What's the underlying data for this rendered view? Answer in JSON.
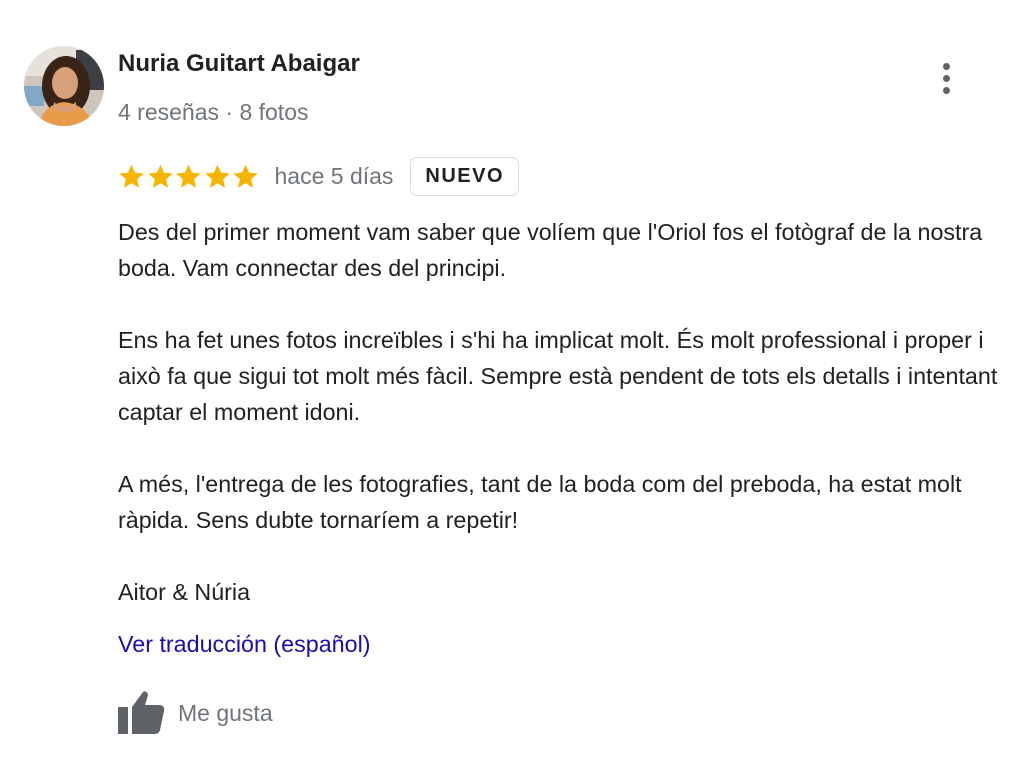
{
  "author": {
    "name": "Nuria Guitart Abaigar",
    "meta": "4 reseñas · 8 fotos"
  },
  "rating": {
    "stars": 5,
    "max_stars": 5,
    "star_color": "#f4b400",
    "time": "hace 5 días",
    "badge": "NUEVO"
  },
  "review": {
    "paragraphs": [
      "Des del primer moment vam saber que volíem que l'Oriol fos el fotògraf de la nostra boda. Vam connectar des del principi.",
      "Ens ha fet unes fotos increïbles i s'hi ha implicat molt. És molt professional i proper i això fa que sigui tot molt més fàcil. Sempre està pendent de tots els detalls i intentant captar el moment idoni.",
      "A més, l'entrega de les fotografies, tant de la boda com del preboda, ha estat molt ràpida. Sens dubte tornaríem a repetir!",
      "Aitor & Núria"
    ]
  },
  "actions": {
    "translate_label": "Ver traducción (español)",
    "like_label": "Me gusta",
    "link_color": "#1a0dab"
  },
  "icons": {
    "more": "more-vert-icon",
    "like": "thumb-up-icon",
    "star": "star-icon"
  }
}
